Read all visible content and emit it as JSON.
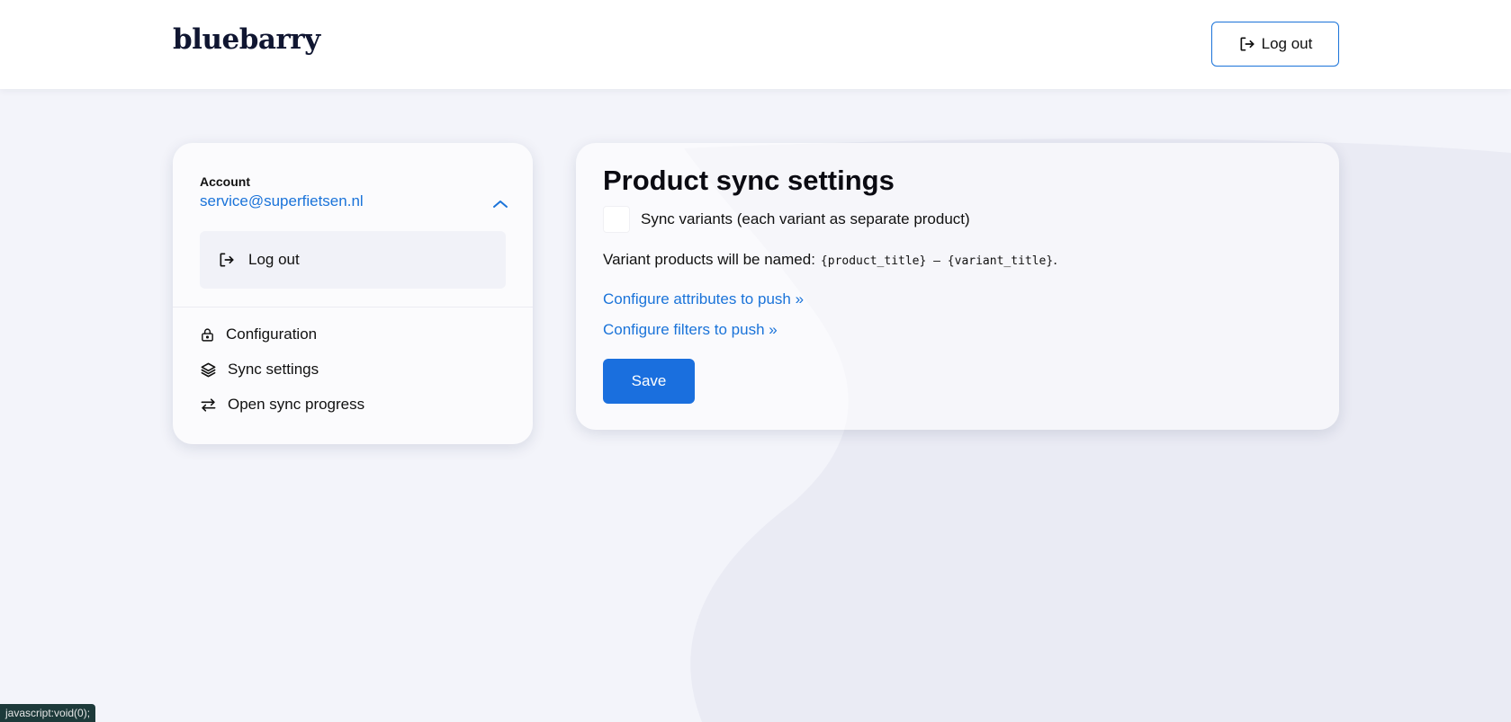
{
  "header": {
    "logo": "bluebarry",
    "logout_label": "Log out"
  },
  "sidebar": {
    "account_label": "Account",
    "account_email": "service@superfietsen.nl",
    "logout_label": "Log out",
    "items": [
      {
        "label": "Configuration",
        "icon": "lock-icon"
      },
      {
        "label": "Sync settings",
        "icon": "layers-icon"
      },
      {
        "label": "Open sync progress",
        "icon": "arrows-exchange-icon"
      }
    ]
  },
  "main": {
    "title": "Product sync settings",
    "checkbox_label": "Sync variants (each variant as separate product)",
    "checkbox_checked": false,
    "variant_text": "Variant products will be named:",
    "variant_code": "{product_title} – {variant_title}",
    "variant_period": ".",
    "link_attributes": "Configure attributes to push »",
    "link_filters": "Configure filters to push »",
    "save_label": "Save"
  },
  "status_bar": {
    "text": "javascript:void(0);"
  },
  "colors": {
    "accent": "#1a73d9",
    "button": "#1a6fde",
    "background": "#f3f4fa"
  }
}
